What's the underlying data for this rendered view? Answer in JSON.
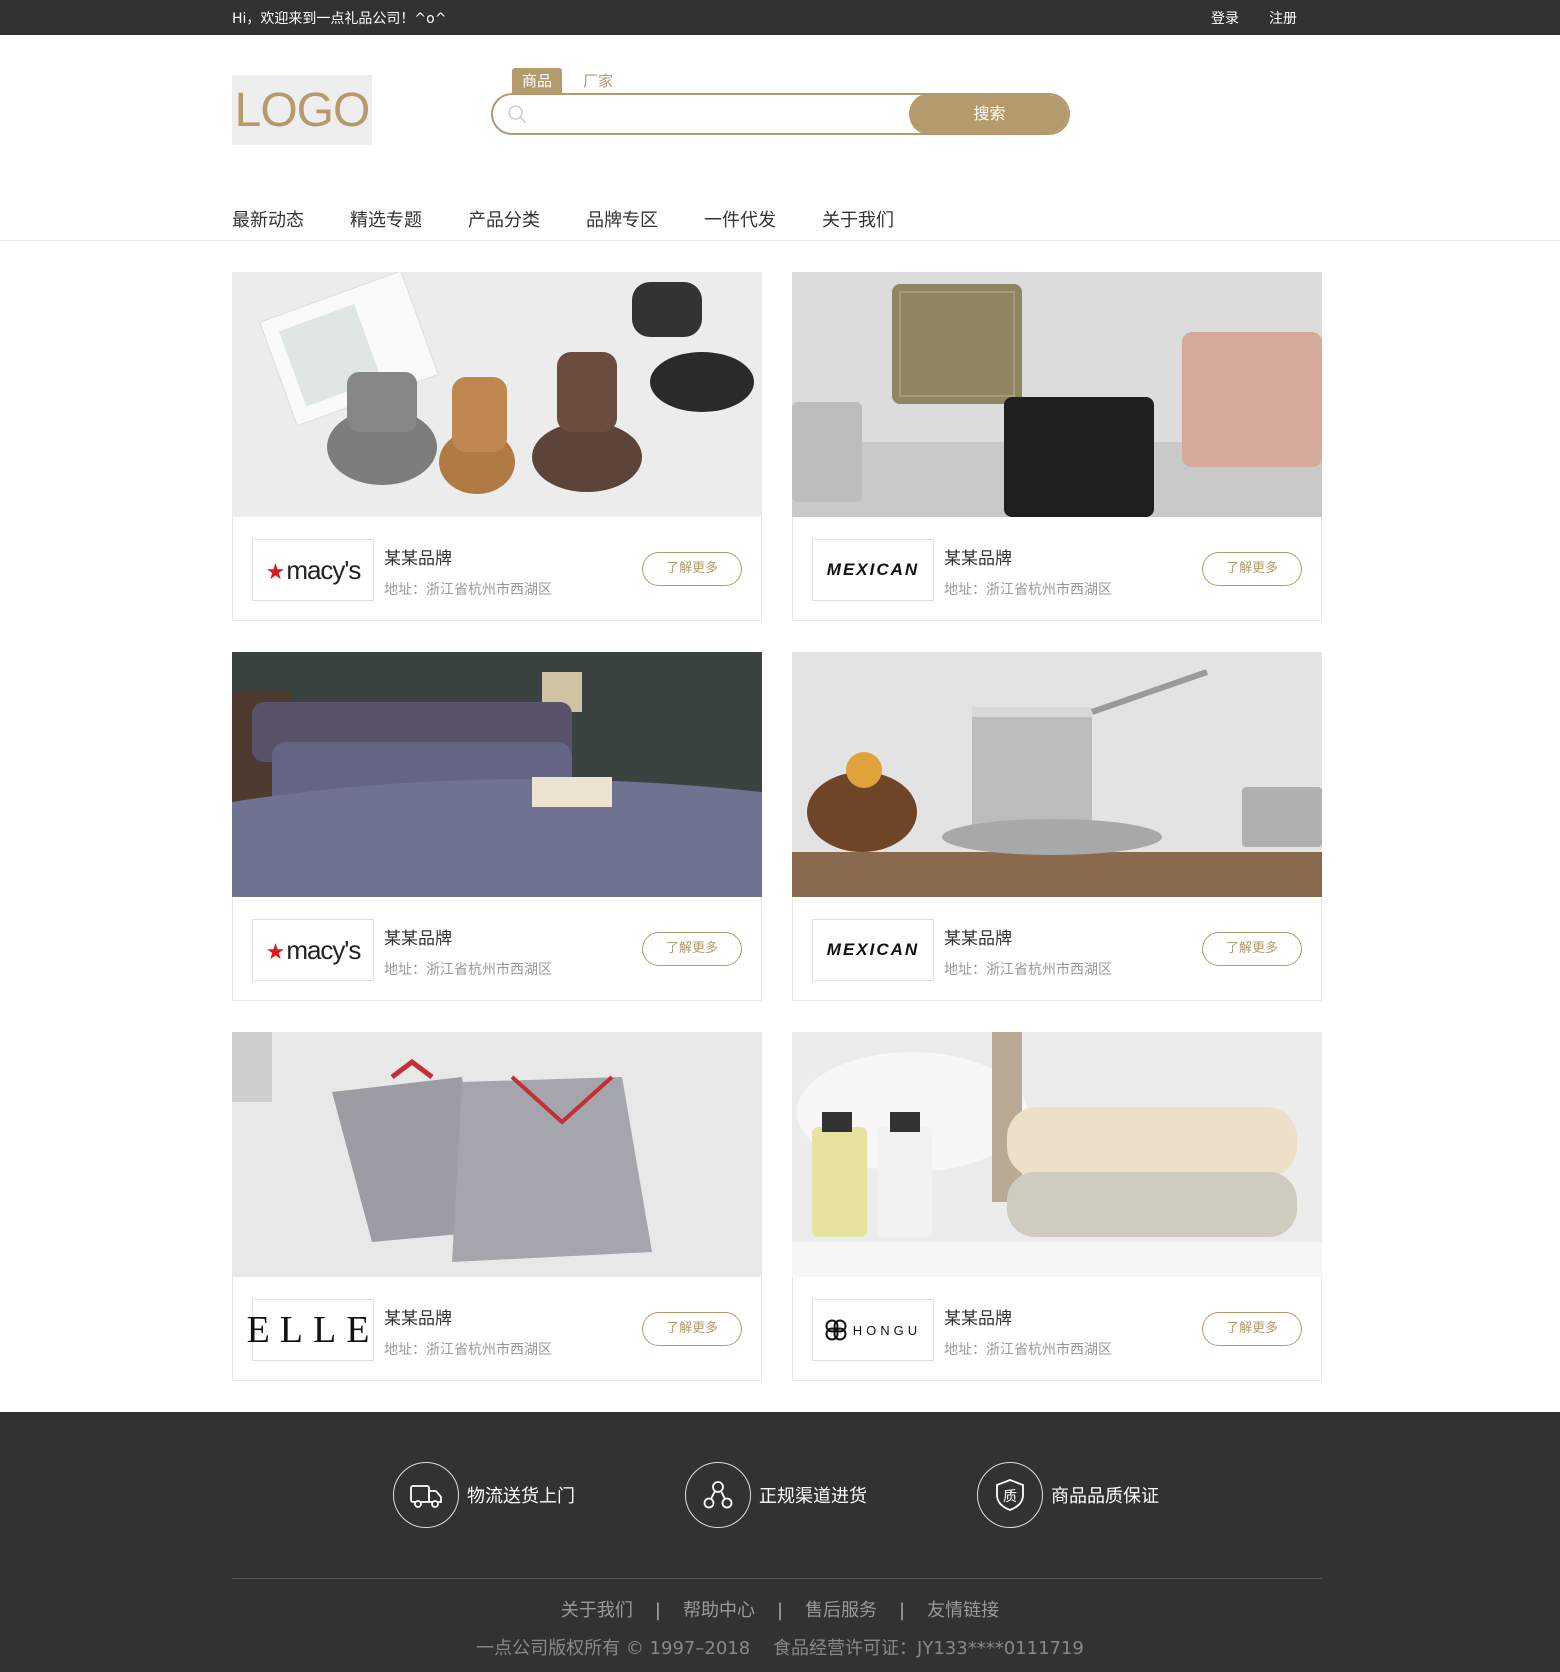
{
  "topbar": {
    "welcome": "Hi，欢迎来到一点礼品公司！^o^",
    "login": "登录",
    "register": "注册"
  },
  "header": {
    "logo": "LOGO",
    "search": {
      "tabs": [
        "商品",
        "厂家"
      ],
      "active_tab": "商品",
      "placeholder": "",
      "button": "搜索"
    }
  },
  "nav": {
    "items": [
      "最新动态",
      "精选专题",
      "产品分类",
      "品牌专区",
      "一件代发",
      "关于我们"
    ]
  },
  "cards": [
    {
      "image": "ugg boots",
      "brand_logo": "macy's",
      "brand": "某某品牌",
      "address": "地址：浙江省杭州市西湖区",
      "button": "了解更多"
    },
    {
      "image": "suitcases",
      "brand_logo": "MEXICAN",
      "brand": "某某品牌",
      "address": "地址：浙江省杭州市西湖区",
      "button": "了解更多"
    },
    {
      "image": "bedding",
      "brand_logo": "macy's",
      "brand": "某某品牌",
      "address": "地址：浙江省杭州市西湖区",
      "button": "了解更多"
    },
    {
      "image": "cookware",
      "brand_logo": "MEXICAN",
      "brand": "某某品牌",
      "address": "地址：浙江省杭州市西湖区",
      "button": "了解更多"
    },
    {
      "image": "pajamas",
      "brand_logo": "ELLE",
      "brand": "某某品牌",
      "address": "地址：浙江省杭州市西湖区",
      "button": "了解更多"
    },
    {
      "image": "towels",
      "brand_logo": "HONGU",
      "brand": "某某品牌",
      "address": "地址：浙江省杭州市西湖区",
      "button": "了解更多"
    }
  ],
  "footer": {
    "features": [
      {
        "icon": "truck-icon",
        "label": "物流送货上门"
      },
      {
        "icon": "channel-icon",
        "label": "正规渠道进货"
      },
      {
        "icon": "quality-shield-icon",
        "label": "商品品质保证"
      }
    ],
    "links": [
      "关于我们",
      "帮助中心",
      "售后服务",
      "友情链接"
    ],
    "copyright": "一点公司版权所有 © 1997–2018    食品经营许可证：JY133****0111719"
  },
  "colors": {
    "accent": "#b49a6c",
    "dark": "#323232",
    "brand_red": "#d71920"
  }
}
